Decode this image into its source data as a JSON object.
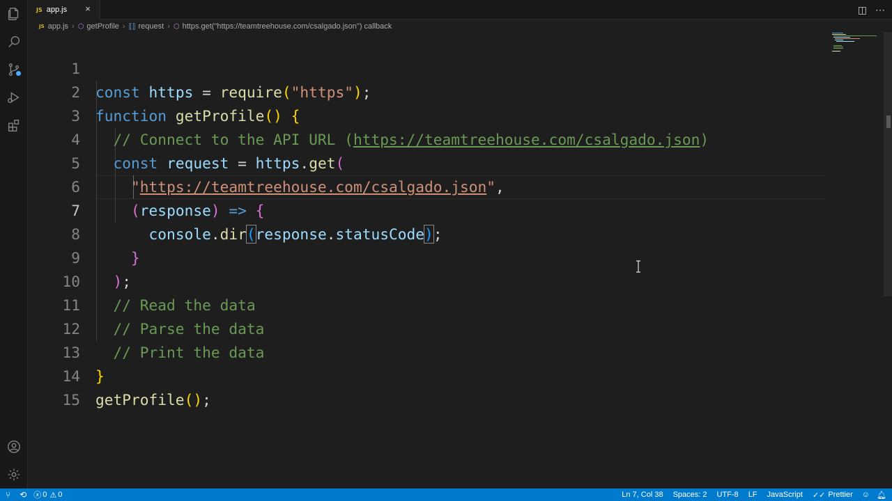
{
  "tabs": [
    {
      "icon_text": "JS",
      "label": "app.js",
      "close": "×"
    }
  ],
  "breadcrumb": {
    "file_icon": "JS",
    "file": "app.js",
    "separator": "›",
    "items": [
      "getProfile",
      "request",
      "https.get(\"https://teamtreehouse.com/csalgado.json\") callback"
    ]
  },
  "editor": {
    "current_line": 7,
    "line_numbers": [
      "1",
      "2",
      "3",
      "4",
      "5",
      "6",
      "7",
      "8",
      "9",
      "10",
      "11",
      "12",
      "13",
      "14",
      "15"
    ],
    "tokens": {
      "l1": [
        "const",
        " ",
        "https",
        " = ",
        "require",
        "(",
        "\"https\"",
        ")",
        ";"
      ],
      "l2": [
        "function",
        " ",
        "getProfile",
        "()",
        " ",
        "{"
      ],
      "l3": [
        "  // Connect to the API URL (",
        "https://teamtreehouse.com/csalgado.json",
        ")"
      ],
      "l4": [
        "  ",
        "const",
        " ",
        "request",
        " = ",
        "https",
        ".",
        "get",
        "("
      ],
      "l5": [
        "    ",
        "\"",
        "https://teamtreehouse.com/csalgado.json",
        "\"",
        ","
      ],
      "l6": [
        "    ",
        "(",
        "response",
        ")",
        " ",
        "=>",
        " ",
        "{"
      ],
      "l7": [
        "      ",
        "console",
        ".",
        "dir",
        "(",
        "response",
        ".",
        "statusCode",
        ")",
        ";"
      ],
      "l8": [
        "    ",
        "}"
      ],
      "l9": [
        "  ",
        ")",
        ";"
      ],
      "l10": [
        "  // Read the data"
      ],
      "l11": [
        "  // Parse the data"
      ],
      "l12": [
        "  // Print the data"
      ],
      "l13": [
        "}"
      ],
      "l14": [
        "getProfile",
        "()",
        ";"
      ]
    }
  },
  "statusbar": {
    "errors": "0",
    "warnings": "0",
    "position": "Ln 7, Col 38",
    "spaces": "Spaces: 2",
    "encoding": "UTF-8",
    "eol": "LF",
    "language": "JavaScript",
    "formatter": "Prettier"
  },
  "colors": {
    "status_bar": "#007acc",
    "keyword": "#569cd6",
    "string": "#ce9178",
    "comment": "#6a9955",
    "function": "#dcdcaa",
    "variable": "#9cdcfe"
  }
}
